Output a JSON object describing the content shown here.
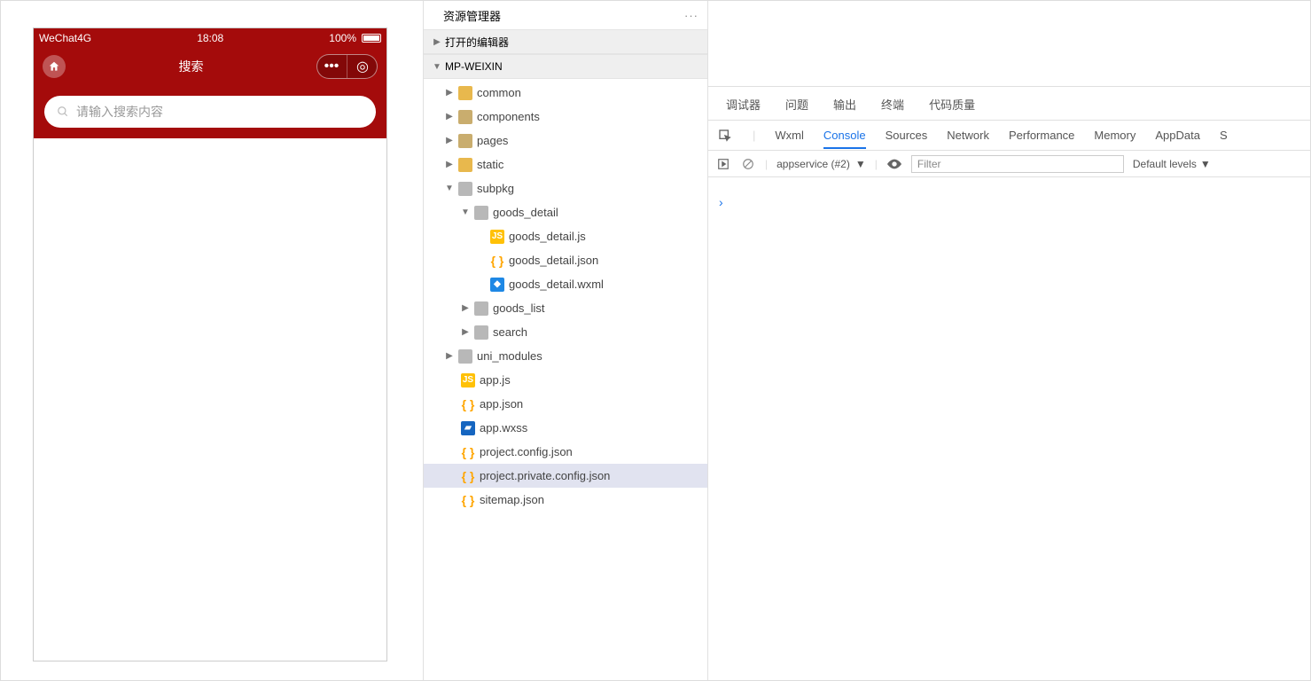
{
  "simulator": {
    "carrier": "WeChat4G",
    "time": "18:08",
    "battery": "100%",
    "title": "搜索",
    "search_placeholder": "请输入搜索内容"
  },
  "explorer": {
    "title": "资源管理器",
    "open_editors": "打开的编辑器",
    "root": "MP-WEIXIN",
    "tree": [
      {
        "name": "common",
        "type": "folder",
        "depth": 0,
        "closed": true
      },
      {
        "name": "components",
        "type": "folder",
        "depth": 0,
        "closed": true,
        "color": "open"
      },
      {
        "name": "pages",
        "type": "folder",
        "depth": 0,
        "closed": true,
        "color": "open"
      },
      {
        "name": "static",
        "type": "folder",
        "depth": 0,
        "closed": true
      },
      {
        "name": "subpkg",
        "type": "folder",
        "depth": 0,
        "closed": false,
        "color": "grey"
      },
      {
        "name": "goods_detail",
        "type": "folder",
        "depth": 1,
        "closed": false,
        "color": "grey"
      },
      {
        "name": "goods_detail.js",
        "type": "js",
        "depth": 2
      },
      {
        "name": "goods_detail.json",
        "type": "json",
        "depth": 2
      },
      {
        "name": "goods_detail.wxml",
        "type": "wxml",
        "depth": 2
      },
      {
        "name": "goods_list",
        "type": "folder",
        "depth": 1,
        "closed": true,
        "color": "grey"
      },
      {
        "name": "search",
        "type": "folder",
        "depth": 1,
        "closed": true,
        "color": "grey"
      },
      {
        "name": "uni_modules",
        "type": "folder",
        "depth": 0,
        "closed": true,
        "color": "grey"
      },
      {
        "name": "app.js",
        "type": "js",
        "depth": 0,
        "leaf": true
      },
      {
        "name": "app.json",
        "type": "json",
        "depth": 0,
        "leaf": true
      },
      {
        "name": "app.wxss",
        "type": "wxss",
        "depth": 0,
        "leaf": true
      },
      {
        "name": "project.config.json",
        "type": "json",
        "depth": 0,
        "leaf": true
      },
      {
        "name": "project.private.config.json",
        "type": "json",
        "depth": 0,
        "leaf": true,
        "selected": true
      },
      {
        "name": "sitemap.json",
        "type": "json",
        "depth": 0,
        "leaf": true
      }
    ]
  },
  "devtools": {
    "tabs_cn": [
      "调试器",
      "问题",
      "输出",
      "终端",
      "代码质量"
    ],
    "tabs_en": [
      "Wxml",
      "Console",
      "Sources",
      "Network",
      "Performance",
      "Memory",
      "AppData",
      "S"
    ],
    "active_tab": "Console",
    "context": "appservice (#2)",
    "filter_placeholder": "Filter",
    "levels": "Default levels"
  }
}
